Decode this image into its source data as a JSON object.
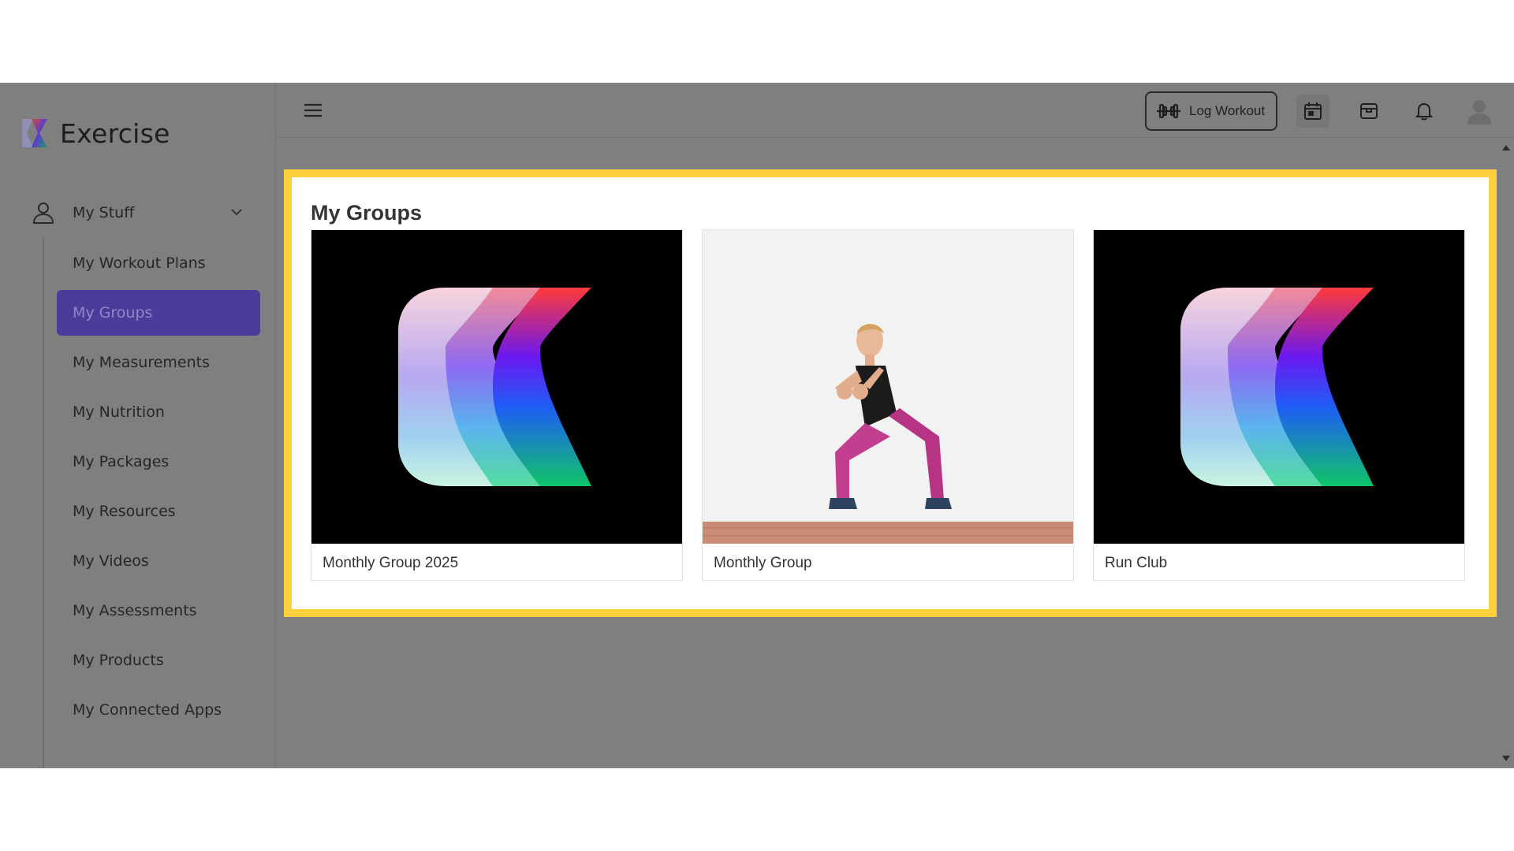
{
  "app": {
    "name": "Exercise"
  },
  "sidebar": {
    "section": {
      "label": "My Stuff",
      "icon": "person-icon",
      "expanded": true
    },
    "items": [
      {
        "label": "My Workout Plans",
        "active": false
      },
      {
        "label": "My Groups",
        "active": true
      },
      {
        "label": "My Measurements",
        "active": false
      },
      {
        "label": "My Nutrition",
        "active": false
      },
      {
        "label": "My Packages",
        "active": false
      },
      {
        "label": "My Resources",
        "active": false
      },
      {
        "label": "My Videos",
        "active": false
      },
      {
        "label": "My Assessments",
        "active": false
      },
      {
        "label": "My Products",
        "active": false
      },
      {
        "label": "My Connected Apps",
        "active": false
      }
    ]
  },
  "topbar": {
    "log_workout_label": "Log Workout",
    "icons": [
      "menu-icon",
      "dumbbell-icon",
      "calendar-icon",
      "package-icon",
      "bell-icon",
      "avatar-icon"
    ]
  },
  "main": {
    "title": "My Groups",
    "groups": [
      {
        "title": "Monthly Group 2025",
        "image": "exercise-logo-image"
      },
      {
        "title": "Monthly Group",
        "image": "woman-squat-photo"
      },
      {
        "title": "Run Club",
        "image": "exercise-logo-image"
      }
    ]
  },
  "colors": {
    "overlay": "#7f7f7f",
    "active_nav": "#4a3c98",
    "highlight_border": "#ffd03d",
    "panel": "#ffffff"
  }
}
